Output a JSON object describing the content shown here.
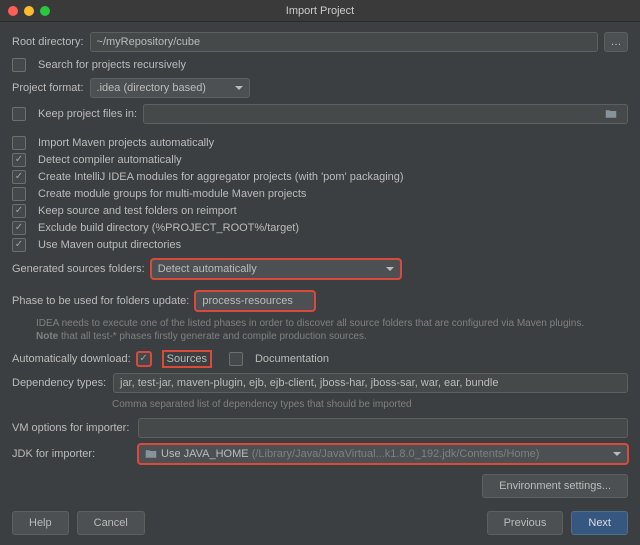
{
  "window": {
    "title": "Import Project"
  },
  "rootDir": {
    "label": "Root directory:",
    "value": "~/myRepository/cube"
  },
  "searchRecursively": {
    "label": "Search for projects recursively",
    "checked": false
  },
  "projectFormat": {
    "label": "Project format:",
    "value": ".idea (directory based)"
  },
  "keepFilesIn": {
    "label": "Keep project files in:",
    "checked": false,
    "value": ""
  },
  "mavenOptions": [
    {
      "label": "Import Maven projects automatically",
      "checked": false
    },
    {
      "label": "Detect compiler automatically",
      "checked": true
    },
    {
      "label": "Create IntelliJ IDEA modules for aggregator projects (with 'pom' packaging)",
      "checked": true
    },
    {
      "label": "Create module groups for multi-module Maven projects",
      "checked": false
    },
    {
      "label": "Keep source and test folders on reimport",
      "checked": true
    },
    {
      "label": "Exclude build directory (%PROJECT_ROOT%/target)",
      "checked": true
    },
    {
      "label": "Use Maven output directories",
      "checked": true
    }
  ],
  "generatedSources": {
    "label": "Generated sources folders:",
    "value": "Detect automatically"
  },
  "phase": {
    "label": "Phase to be used for folders update:",
    "value": "process-resources",
    "hint": "IDEA needs to execute one of the listed phases in order to discover all source folders that are configured via Maven plugins.\nNote that all test-* phases firstly generate and compile production sources."
  },
  "autoDownload": {
    "label": "Automatically download:",
    "sources": {
      "label": "Sources",
      "checked": true
    },
    "docs": {
      "label": "Documentation",
      "checked": false
    }
  },
  "dependencyTypes": {
    "label": "Dependency types:",
    "value": "jar, test-jar, maven-plugin, ejb, ejb-client, jboss-har, jboss-sar, war, ear, bundle",
    "hint": "Comma separated list of dependency types that should be imported"
  },
  "vmOptions": {
    "label": "VM options for importer:",
    "value": ""
  },
  "jdk": {
    "label": "JDK for importer:",
    "value": "Use JAVA_HOME",
    "path": "(/Library/Java/JavaVirtual...k1.8.0_192.jdk/Contents/Home)"
  },
  "buttons": {
    "envSettings": "Environment settings...",
    "help": "Help",
    "cancel": "Cancel",
    "previous": "Previous",
    "next": "Next"
  }
}
